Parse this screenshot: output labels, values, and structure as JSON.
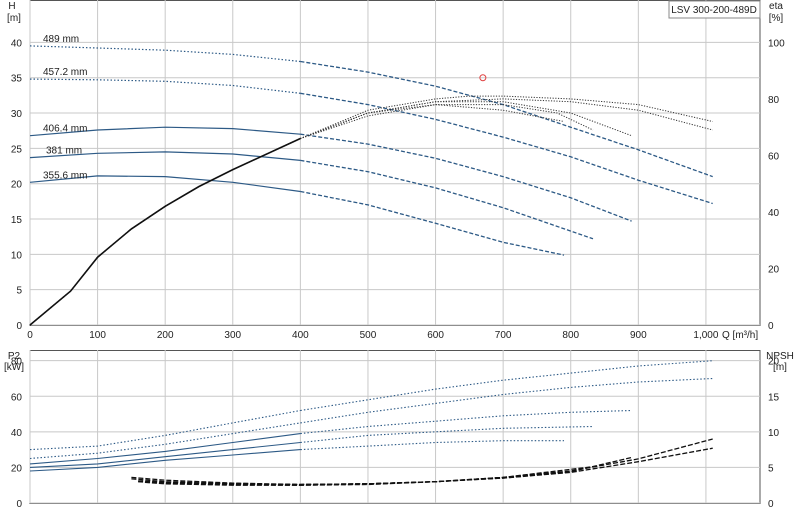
{
  "chart_data": [
    {
      "type": "line",
      "title": "LSV 300-200-489D",
      "xlabel": "Q [m³/h]",
      "ylabel_left": [
        "H",
        "[m]"
      ],
      "ylabel_right": [
        "eta",
        "[%]"
      ],
      "xlim": [
        0,
        1080
      ],
      "ylim": [
        0,
        46
      ],
      "ylim_right": [
        0,
        115
      ],
      "x_ticks": [
        "0",
        "100",
        "200",
        "300",
        "400",
        "500",
        "600",
        "700",
        "800",
        "900",
        "1,000"
      ],
      "y_ticks": [
        "0",
        "5",
        "10",
        "15",
        "20",
        "25",
        "30",
        "35",
        "40"
      ],
      "y_right_ticks": [
        "0",
        "20",
        "40",
        "60",
        "80",
        "100"
      ],
      "grid": true,
      "duty_point": {
        "x": 670,
        "y": 35
      },
      "head_curves": [
        {
          "name": "489 mm",
          "x": [
            0,
            100,
            200,
            300,
            400,
            500,
            600,
            700,
            800,
            900,
            1010
          ],
          "y": [
            39.5,
            39.2,
            38.9,
            38.3,
            37.3,
            35.8,
            33.8,
            31.2,
            28.0,
            24.8,
            21.0
          ]
        },
        {
          "name": "457.2 mm",
          "x": [
            0,
            100,
            200,
            300,
            400,
            500,
            600,
            700,
            800,
            900,
            1010
          ],
          "y": [
            34.8,
            34.7,
            34.5,
            33.9,
            32.8,
            31.2,
            29.1,
            26.6,
            23.8,
            20.5,
            17.2
          ]
        },
        {
          "name": "406.4 mm",
          "x": [
            0,
            100,
            200,
            300,
            400,
            500,
            600,
            700,
            800,
            890
          ],
          "y": [
            26.8,
            27.6,
            28.0,
            27.8,
            27.0,
            25.6,
            23.6,
            21.0,
            18.0,
            14.7
          ]
        },
        {
          "name": "381 mm",
          "x": [
            0,
            100,
            200,
            300,
            400,
            500,
            600,
            700,
            833
          ],
          "y": [
            23.7,
            24.3,
            24.5,
            24.2,
            23.3,
            21.7,
            19.4,
            16.6,
            12.2
          ]
        },
        {
          "name": "355.6 mm",
          "x": [
            0,
            100,
            200,
            300,
            400,
            500,
            600,
            700,
            790
          ],
          "y": [
            20.2,
            21.1,
            21.0,
            20.2,
            18.9,
            17.0,
            14.4,
            11.7,
            9.9
          ]
        }
      ],
      "efficiency_curves": [
        {
          "x": [
            0,
            60,
            100,
            150,
            200,
            250,
            300,
            400,
            500,
            600,
            650,
            700,
            800,
            900,
            1010
          ],
          "y": [
            0,
            12,
            24,
            34,
            42,
            49,
            55,
            66,
            76,
            80,
            81,
            81,
            80,
            78,
            72
          ]
        },
        {
          "x": [
            0,
            60,
            100,
            150,
            200,
            250,
            300,
            400,
            500,
            600,
            700,
            800,
            900,
            1010
          ],
          "y": [
            0,
            12,
            24,
            34,
            42,
            49,
            55,
            66,
            75,
            79,
            80,
            79,
            76,
            69
          ]
        },
        {
          "x": [
            0,
            60,
            100,
            150,
            200,
            250,
            300,
            400,
            500,
            600,
            700,
            800,
            890
          ],
          "y": [
            0,
            12,
            24,
            34,
            42,
            49,
            55,
            66,
            75,
            79,
            79,
            75,
            67
          ]
        },
        {
          "x": [
            0,
            60,
            100,
            150,
            200,
            250,
            300,
            400,
            500,
            600,
            700,
            780,
            833
          ],
          "y": [
            0,
            12,
            24,
            34,
            42,
            49,
            55,
            66,
            75,
            78,
            78,
            75,
            69
          ]
        },
        {
          "x": [
            0,
            60,
            100,
            150,
            200,
            250,
            300,
            400,
            500,
            600,
            700,
            790
          ],
          "y": [
            0,
            12,
            24,
            34,
            42,
            49,
            55,
            66,
            74,
            78,
            76,
            72
          ]
        }
      ]
    },
    {
      "type": "line",
      "xlim": [
        0,
        1080
      ],
      "ylabel_left": [
        "P2",
        "[kW]"
      ],
      "ylabel_right": [
        "NPSH",
        "[m]"
      ],
      "ylim": [
        0,
        86
      ],
      "ylim_right": [
        0,
        21.5
      ],
      "y_ticks": [
        "0",
        "20",
        "40",
        "60",
        "80"
      ],
      "y_right_ticks": [
        "0",
        "5",
        "10",
        "15",
        "20"
      ],
      "grid": true,
      "power_curves": [
        {
          "x": [
            0,
            100,
            200,
            300,
            400,
            500,
            600,
            700,
            800,
            900,
            1010
          ],
          "y": [
            30,
            32,
            38,
            45,
            52,
            58,
            64,
            69,
            73,
            77,
            80
          ]
        },
        {
          "x": [
            0,
            100,
            200,
            300,
            400,
            500,
            600,
            700,
            800,
            900,
            1010
          ],
          "y": [
            25,
            28,
            33,
            39,
            45,
            51,
            56,
            61,
            65,
            68,
            70
          ]
        },
        {
          "x": [
            0,
            100,
            200,
            300,
            400,
            500,
            600,
            700,
            800,
            890
          ],
          "y": [
            22,
            25,
            29,
            34,
            39,
            43,
            46,
            49,
            51,
            52
          ]
        },
        {
          "x": [
            0,
            100,
            200,
            300,
            400,
            500,
            600,
            700,
            833
          ],
          "y": [
            20,
            22,
            26,
            30,
            34,
            38,
            40,
            42,
            43
          ]
        },
        {
          "x": [
            0,
            100,
            200,
            300,
            400,
            500,
            600,
            700,
            790
          ],
          "y": [
            18,
            20,
            24,
            27,
            30,
            32,
            34,
            35,
            35
          ]
        }
      ],
      "npsh_curves": [
        {
          "x": [
            150,
            200,
            300,
            400,
            500,
            600,
            700,
            800,
            900,
            1010
          ],
          "y": [
            3.6,
            3.2,
            2.8,
            2.6,
            2.7,
            3.0,
            3.6,
            4.5,
            6.2,
            9.0
          ]
        },
        {
          "x": [
            150,
            200,
            300,
            400,
            500,
            600,
            700,
            800,
            900,
            1010
          ],
          "y": [
            3.4,
            3.0,
            2.7,
            2.6,
            2.7,
            3.0,
            3.5,
            4.3,
            5.8,
            7.7
          ]
        },
        {
          "x": [
            160,
            200,
            300,
            400,
            500,
            600,
            700,
            800,
            890
          ],
          "y": [
            3.1,
            2.9,
            2.7,
            2.6,
            2.7,
            3.0,
            3.5,
            4.4,
            6.4
          ]
        },
        {
          "x": [
            160,
            200,
            300,
            400,
            500,
            600,
            700,
            833
          ],
          "y": [
            3.0,
            2.8,
            2.6,
            2.5,
            2.7,
            3.0,
            3.6,
            5.1
          ]
        },
        {
          "x": [
            170,
            200,
            300,
            400,
            500,
            600,
            700,
            790
          ],
          "y": [
            2.9,
            2.7,
            2.5,
            2.5,
            2.6,
            3.0,
            3.6,
            4.4
          ]
        }
      ]
    }
  ]
}
